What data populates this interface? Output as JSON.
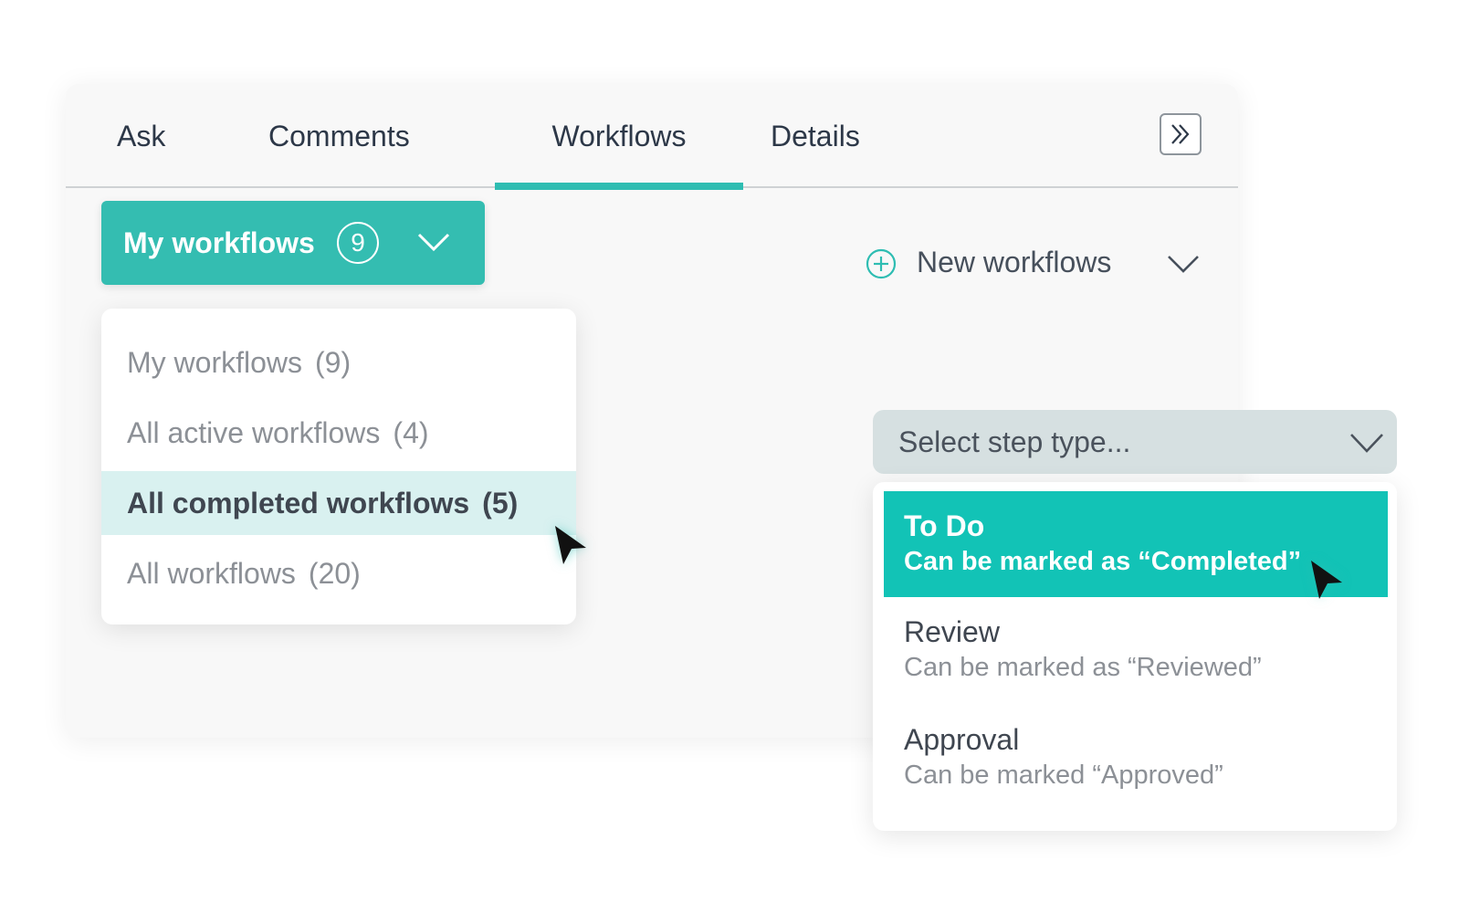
{
  "tabs": [
    {
      "label": "Ask",
      "active": false
    },
    {
      "label": "Comments",
      "active": false
    },
    {
      "label": "Workflows",
      "active": true
    },
    {
      "label": "Details",
      "active": false
    }
  ],
  "collapse_icon": "double-chevron-right-icon",
  "my_workflows_button": {
    "label": "My workflows",
    "count": "9"
  },
  "workflow_filter_menu": [
    {
      "label": "My workflows",
      "count": "(9)"
    },
    {
      "label": "All active workflows",
      "count": "(4)"
    },
    {
      "label": "All completed workflows",
      "count": "(5)",
      "selected": true
    },
    {
      "label": "All workflows",
      "count": "(20)"
    }
  ],
  "new_workflows": {
    "label": "New workflows",
    "icon": "plus-circle-icon"
  },
  "step_type_select": {
    "placeholder": "Select step type..."
  },
  "step_type_options": [
    {
      "title": "To Do",
      "subtitle": "Can be marked as “Completed”",
      "selected": true
    },
    {
      "title": "Review",
      "subtitle": "Can be marked as “Reviewed”"
    },
    {
      "title": "Approval",
      "subtitle": "Can be marked “Approved”"
    }
  ],
  "colors": {
    "accent": "#34bdb1",
    "selected_option": "#12c3b6",
    "selected_row_bg": "#d9f1f0",
    "select_bg": "#d6e0e1",
    "text_dark": "#2d3848",
    "text_muted": "#8c9096"
  }
}
